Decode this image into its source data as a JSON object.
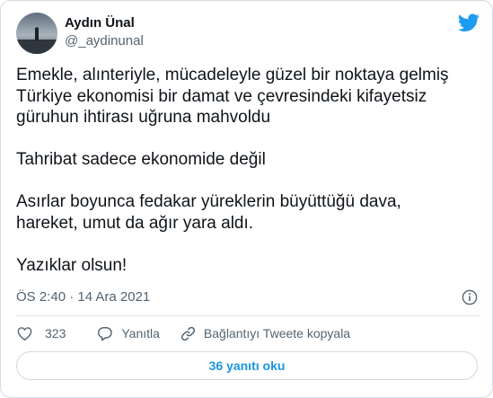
{
  "author": {
    "name": "Aydın Ünal",
    "handle": "@_aydinunal"
  },
  "tweet": {
    "text": "Emekle, alınteriyle, mücadeleyle güzel bir noktaya gelmiş\nTürkiye ekonomisi bir damat ve çevresindeki kifayetsiz\ngüruhun ihtirası uğruna mahvoldu\n\nTahribat sadece ekonomide değil\n\nAsırlar boyunca fedakar yüreklerin büyüttüğü dava,\nhareket, umut da ağır yara aldı.\n\nYazıklar olsun!",
    "timestamp": "ÖS 2:40 · 14 Ara 2021"
  },
  "actions": {
    "likes": "323",
    "reply_label": "Yanıtla",
    "copy_link_label": "Bağlantıyı Tweete kopyala"
  },
  "replies_button": "36 yanıtı oku",
  "icons": {
    "brand": "twitter-bird-icon",
    "info": "info-icon",
    "like": "heart-icon",
    "reply": "reply-bubble-icon",
    "link": "link-icon"
  },
  "colors": {
    "brand": "#1d9bf0",
    "link_text": "#1b95e0",
    "secondary_text": "#536471"
  }
}
